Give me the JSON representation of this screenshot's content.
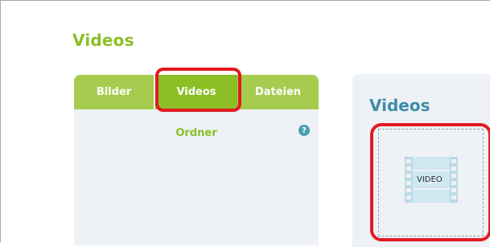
{
  "page": {
    "title": "Videos"
  },
  "tabs": [
    {
      "label": "Bilder",
      "active": false
    },
    {
      "label": "Videos",
      "active": true
    },
    {
      "label": "Dateien",
      "active": false
    }
  ],
  "folders": {
    "label": "Ordner",
    "help_icon": "?"
  },
  "content": {
    "title": "Videos",
    "item": {
      "label": "VIDEO",
      "icon": "film-strip-icon"
    }
  },
  "colors": {
    "accent_green": "#8bbf26",
    "tab_green": "#a6cc4f",
    "title_blue": "#3f8ca9",
    "panel_bg": "#eef1f5",
    "highlight_red": "#e11b22"
  }
}
